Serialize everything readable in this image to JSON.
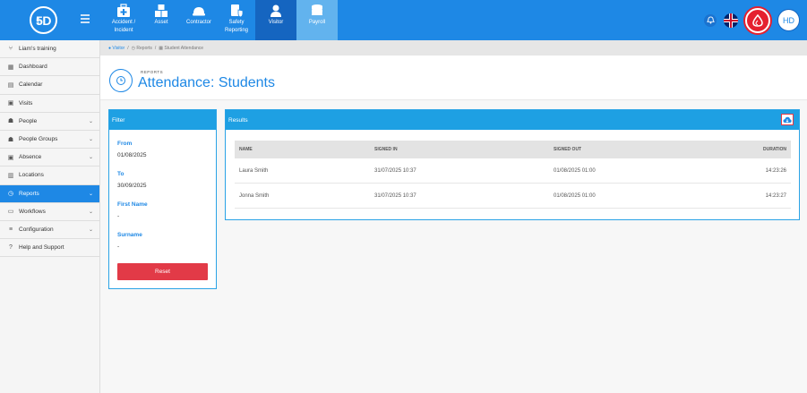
{
  "brand": {
    "logo_text": "5D",
    "logo_small": "STEP"
  },
  "modules": [
    {
      "label_line1": "Accident /",
      "label_line2": "Incident",
      "icon": "first-aid-kit-icon"
    },
    {
      "label_line1": "Asset",
      "label_line2": "",
      "icon": "boxes-icon"
    },
    {
      "label_line1": "Contractor",
      "label_line2": "",
      "icon": "hard-hat-icon"
    },
    {
      "label_line1": "Safety",
      "label_line2": "Reporting",
      "icon": "report-shield-icon"
    },
    {
      "label_line1": "Visitor",
      "label_line2": "",
      "icon": "person-icon"
    },
    {
      "label_line1": "Payroll",
      "label_line2": "",
      "icon": "coins-icon"
    }
  ],
  "user": {
    "initials": "HD"
  },
  "sidebar": {
    "items": [
      {
        "label": "Liam's training",
        "icon": "branch-icon",
        "chevron": ""
      },
      {
        "label": "Dashboard",
        "icon": "grid-icon",
        "chevron": ""
      },
      {
        "label": "Calendar",
        "icon": "calendar-icon",
        "chevron": ""
      },
      {
        "label": "Visits",
        "icon": "calendar-check-icon",
        "chevron": ""
      },
      {
        "label": "People",
        "icon": "people-icon",
        "chevron": "⌄"
      },
      {
        "label": "People Groups",
        "icon": "people-groups-icon",
        "chevron": "⌄"
      },
      {
        "label": "Absence",
        "icon": "absence-icon",
        "chevron": "⌄"
      },
      {
        "label": "Locations",
        "icon": "building-icon",
        "chevron": ""
      },
      {
        "label": "Reports",
        "icon": "clock-icon",
        "chevron": "⌄"
      },
      {
        "label": "Workflows",
        "icon": "workflow-icon",
        "chevron": "⌄"
      },
      {
        "label": "Configuration",
        "icon": "sliders-icon",
        "chevron": "⌄"
      },
      {
        "label": "Help and Support",
        "icon": "help-icon",
        "chevron": ""
      }
    ]
  },
  "breadcrumb": {
    "first": "Visitor",
    "sep": "/",
    "second": "Reports",
    "third": "Student Attendance"
  },
  "page": {
    "kicker": "REPORTS",
    "title": "Attendance: Students"
  },
  "filter": {
    "title": "Filter",
    "from_label": "From",
    "from_value": "01/08/2025",
    "to_label": "To",
    "to_value": "30/09/2025",
    "first_name_label": "First Name",
    "first_name_value": "-",
    "surname_label": "Surname",
    "surname_value": "-",
    "reset_label": "Reset"
  },
  "results": {
    "title": "Results",
    "headers": [
      "NAME",
      "SIGNED IN",
      "SIGNED OUT",
      "DURATION"
    ],
    "rows": [
      [
        "Laura Smith",
        "31/07/2025 10:37",
        "01/08/2025 01:00",
        "14:23:26"
      ],
      [
        "Jonna Smith",
        "31/07/2025 10:37",
        "01/08/2025 01:00",
        "14:23:27"
      ]
    ]
  }
}
